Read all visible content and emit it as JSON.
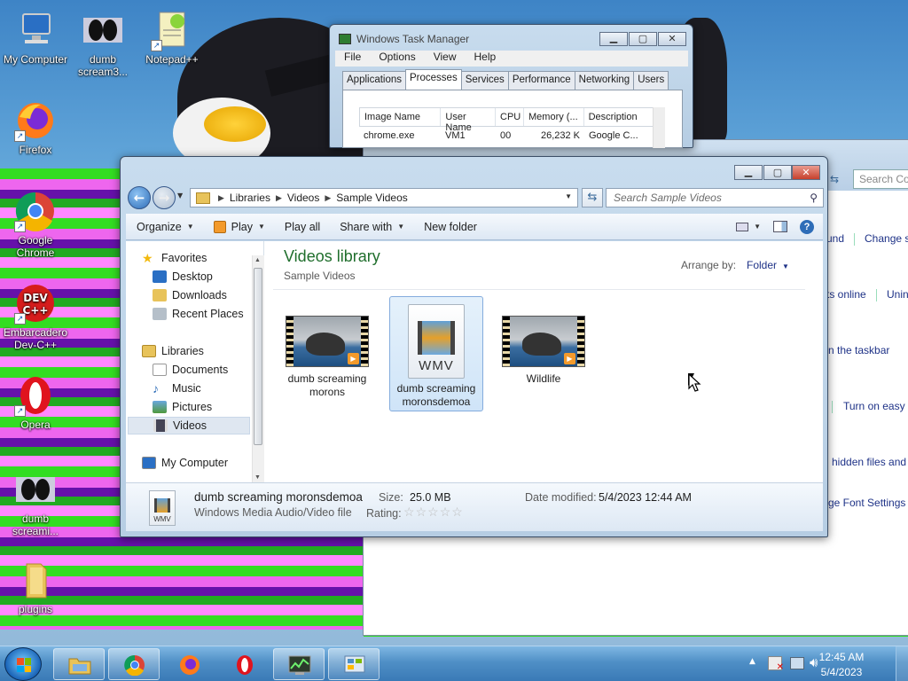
{
  "desktop": {
    "icons": [
      {
        "label": "My Computer",
        "icon": "computer-icon"
      },
      {
        "label": "dumb scream3...",
        "icon": "video-thumbnail-icon"
      },
      {
        "label": "Notepad++",
        "icon": "notepad-plus-plus-icon"
      },
      {
        "label": "Firefox",
        "icon": "firefox-icon"
      },
      {
        "label": "Google Chrome",
        "icon": "chrome-icon"
      },
      {
        "label": "Embarcadero Dev-C++",
        "icon": "devcpp-icon"
      },
      {
        "label": "Opera",
        "icon": "opera-icon"
      },
      {
        "label": "dumb screami...",
        "icon": "video-thumbnail-icon"
      },
      {
        "label": "plugins",
        "icon": "folder-icon"
      }
    ]
  },
  "task_manager": {
    "title": "Windows Task Manager",
    "menu": [
      "File",
      "Options",
      "View",
      "Help"
    ],
    "tabs": [
      "Applications",
      "Processes",
      "Services",
      "Performance",
      "Networking",
      "Users"
    ],
    "active_tab": "Processes",
    "columns": [
      "Image Name",
      "User Name",
      "CPU",
      "Memory (...",
      "Description"
    ],
    "rows": [
      {
        "image": "chrome.exe",
        "user": "VM1",
        "cpu": "00",
        "memory": "26,232 K",
        "description": "Google C..."
      }
    ]
  },
  "background_window": {
    "search_placeholder": "Search Con",
    "links": [
      "und",
      "Change s",
      "ts online",
      "Unin",
      "n the taskbar",
      "Turn on easy a",
      "hidden files and",
      "ge Font Settings"
    ]
  },
  "explorer": {
    "breadcrumb": [
      "Libraries",
      "Videos",
      "Sample Videos"
    ],
    "search_placeholder": "Search Sample Videos",
    "toolbar": {
      "organize": "Organize",
      "play": "Play",
      "play_all": "Play all",
      "share_with": "Share with",
      "new_folder": "New folder"
    },
    "nav": {
      "favorites": "Favorites",
      "desktop": "Desktop",
      "downloads": "Downloads",
      "recent_places": "Recent Places",
      "libraries": "Libraries",
      "documents": "Documents",
      "music": "Music",
      "pictures": "Pictures",
      "videos": "Videos",
      "my_computer": "My Computer"
    },
    "library_title": "Videos library",
    "library_subtitle": "Sample Videos",
    "arrange_label": "Arrange by:",
    "arrange_value": "Folder",
    "files": [
      {
        "name_line1": "dumb screaming",
        "name_line2": "morons",
        "kind": "video-thumbnail",
        "selected": false
      },
      {
        "name_line1": "dumb screaming",
        "name_line2": "moronsdemoa",
        "kind": "wmv-document",
        "badge": "WMV",
        "selected": true
      },
      {
        "name_line1": "Wildlife",
        "name_line2": "",
        "kind": "video-thumbnail",
        "selected": false
      }
    ],
    "details": {
      "filename": "dumb screaming moronsdemoa",
      "filetype": "Windows Media Audio/Video file",
      "size_label": "Size:",
      "size_value": "25.0 MB",
      "date_label": "Date modified:",
      "date_value": "5/4/2023 12:44 AM",
      "rating_label": "Rating:",
      "rating_stars": 0,
      "rating_max": 5,
      "icon_badge": "WMV"
    }
  },
  "taskbar": {
    "apps": [
      "windows-explorer-icon",
      "chrome-icon",
      "firefox-icon",
      "opera-icon",
      "task-manager-icon",
      "control-panel-icon"
    ],
    "time": "12:45 AM",
    "date": "5/4/2023"
  }
}
